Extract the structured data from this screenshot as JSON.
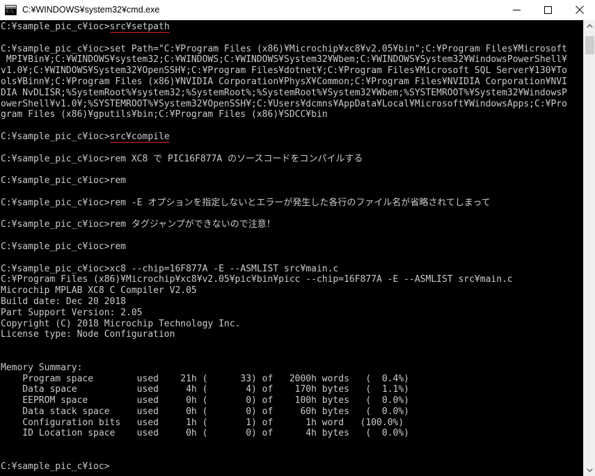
{
  "window": {
    "title": "C:¥WINDOWS¥system32¥cmd.exe",
    "icon": "cmd-console-icon",
    "icon_text": "C:\\",
    "controls": {
      "minimize_label": "Minimize",
      "maximize_label": "Maximize",
      "close_label": "Close"
    },
    "background_color": "#000000",
    "titlebar_color": "#ffffff",
    "text_color": "#cccccc",
    "highlight_color": "#e02020"
  },
  "scrollbar": {
    "up_arrow_label": "Scroll up",
    "down_arrow_label": "Scroll down",
    "thumb_label": "Scroll thumb"
  },
  "console": {
    "prompt": "C:¥sample_pic_c¥ioc>",
    "lines": [
      {
        "id": "l01",
        "text": "C:¥sample_pic_c¥ioc>",
        "cmd": "src¥setpath",
        "underline": true
      },
      {
        "id": "l02",
        "text": ""
      },
      {
        "id": "l03",
        "text": "C:¥sample_pic_c¥ioc>set Path=\"C:¥Program Files (x86)¥Microchip¥xc8¥v2.05¥bin\";C:¥Program Files¥Microsoft"
      },
      {
        "id": "l04",
        "text": " MPI¥Bin¥;C:¥WINDOWS¥system32;C:¥WINDOWS;C:¥WINDOWS¥System32¥Wbem;C:¥WINDOWS¥System32¥WindowsPowerShell¥"
      },
      {
        "id": "l05",
        "text": "v1.0¥;C:¥WINDOWS¥System32¥OpenSSH¥;C:¥Program Files¥dotnet¥;C:¥Program Files¥Microsoft SQL Server¥130¥To"
      },
      {
        "id": "l06",
        "text": "ols¥Binn¥;C:¥Program Files (x86)¥NVIDIA Corporation¥PhysX¥Common;C:¥Program Files¥NVIDIA Corporation¥NVI"
      },
      {
        "id": "l07",
        "text": "DIA NvDLISR;%SystemRoot%¥system32;%SystemRoot%;%SystemRoot%¥System32¥Wbem;%SYSTEMROOT%¥System32¥WindowsP"
      },
      {
        "id": "l08",
        "text": "owerShell¥v1.0¥;%SYSTEMROOT%¥System32¥OpenSSH¥;C:¥Users¥dcmns¥AppData¥Local¥Microsoft¥WindowsApps;C:¥Pro"
      },
      {
        "id": "l09",
        "text": "gram Files (x86)¥gputils¥bin;C:¥Program Files (x86)¥SDCC¥bin"
      },
      {
        "id": "l10",
        "text": ""
      },
      {
        "id": "l11",
        "text": "C:¥sample_pic_c¥ioc>",
        "cmd": "src¥compile",
        "underline": true
      },
      {
        "id": "l12",
        "text": ""
      },
      {
        "id": "l13",
        "text": "C:¥sample_pic_c¥ioc>rem XC8 で PIC16F877A のソースコードをコンパイルする"
      },
      {
        "id": "l14",
        "text": ""
      },
      {
        "id": "l15",
        "text": "C:¥sample_pic_c¥ioc>rem"
      },
      {
        "id": "l16",
        "text": ""
      },
      {
        "id": "l17",
        "text": "C:¥sample_pic_c¥ioc>rem -E オプションを指定しないとエラーが発生した各行のファイル名が省略されてしまって"
      },
      {
        "id": "l18",
        "text": ""
      },
      {
        "id": "l19",
        "text": "C:¥sample_pic_c¥ioc>rem タグジャンプができないので注意！"
      },
      {
        "id": "l20",
        "text": ""
      },
      {
        "id": "l21",
        "text": "C:¥sample_pic_c¥ioc>rem"
      },
      {
        "id": "l22",
        "text": ""
      },
      {
        "id": "l23",
        "text": "C:¥sample_pic_c¥ioc>xc8 --chip=16F877A -E --ASMLIST src¥main.c"
      },
      {
        "id": "l24",
        "text": "C:¥Program Files (x86)¥Microchip¥xc8¥v2.05¥pic¥bin¥picc --chip=16F877A -E --ASMLIST src¥main.c"
      },
      {
        "id": "l25",
        "text": "Microchip MPLAB XC8 C Compiler V2.05"
      },
      {
        "id": "l26",
        "text": "Build date: Dec 20 2018"
      },
      {
        "id": "l27",
        "text": "Part Support Version: 2.05"
      },
      {
        "id": "l28",
        "text": "Copyright (C) 2018 Microchip Technology Inc."
      },
      {
        "id": "l29",
        "text": "License type: Node Configuration"
      },
      {
        "id": "l30",
        "text": ""
      },
      {
        "id": "l31",
        "text": ""
      },
      {
        "id": "l32",
        "text": "Memory Summary:"
      },
      {
        "id": "l33",
        "text": "    Program space        used    21h (      33) of   2000h words   (  0.4%)"
      },
      {
        "id": "l34",
        "text": "    Data space           used     4h (       4) of    170h bytes   (  1.1%)"
      },
      {
        "id": "l35",
        "text": "    EEPROM space         used     0h (       0) of    100h bytes   (  0.0%)"
      },
      {
        "id": "l36",
        "text": "    Data stack space     used     0h (       0) of     60h bytes   (  0.0%)"
      },
      {
        "id": "l37",
        "text": "    Configuration bits   used     1h (       1) of      1h word   (100.0%)"
      },
      {
        "id": "l38",
        "text": "    ID Location space    used     0h (       0) of      4h bytes   (  0.0%)"
      },
      {
        "id": "l39",
        "text": ""
      },
      {
        "id": "l40",
        "text": ""
      },
      {
        "id": "l41",
        "text": "C:¥sample_pic_c¥ioc>"
      }
    ],
    "memory_summary": {
      "heading": "Memory Summary:",
      "columns": [
        "space",
        "state",
        "used_hex",
        "used_dec",
        "of",
        "total",
        "unit",
        "percent"
      ],
      "rows": [
        {
          "space": "Program space",
          "state": "used",
          "used_hex": "21h",
          "used_dec": "33",
          "of": "of",
          "total": "2000h",
          "unit": "words",
          "percent": "0.4%"
        },
        {
          "space": "Data space",
          "state": "used",
          "used_hex": "4h",
          "used_dec": "4",
          "of": "of",
          "total": "170h",
          "unit": "bytes",
          "percent": "1.1%"
        },
        {
          "space": "EEPROM space",
          "state": "used",
          "used_hex": "0h",
          "used_dec": "0",
          "of": "of",
          "total": "100h",
          "unit": "bytes",
          "percent": "0.0%"
        },
        {
          "space": "Data stack space",
          "state": "used",
          "used_hex": "0h",
          "used_dec": "0",
          "of": "of",
          "total": "60h",
          "unit": "bytes",
          "percent": "0.0%"
        },
        {
          "space": "Configuration bits",
          "state": "used",
          "used_hex": "1h",
          "used_dec": "1",
          "of": "of",
          "total": "1h",
          "unit": "word",
          "percent": "100.0%"
        },
        {
          "space": "ID Location space",
          "state": "used",
          "used_hex": "0h",
          "used_dec": "0",
          "of": "of",
          "total": "4h",
          "unit": "bytes",
          "percent": "0.0%"
        }
      ]
    }
  }
}
